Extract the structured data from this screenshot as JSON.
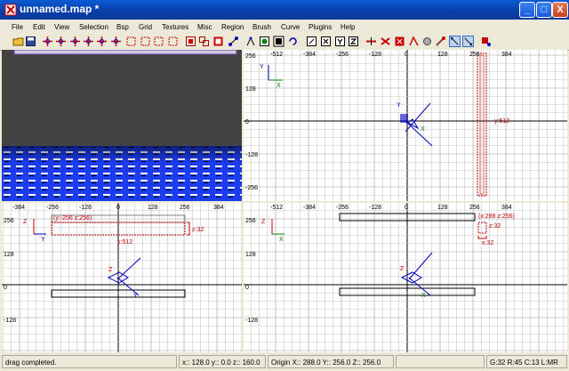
{
  "window": {
    "title": "unnamed.map *",
    "min_label": "_",
    "max_label": "□",
    "close_label": "X"
  },
  "menu": {
    "items": [
      "File",
      "Edit",
      "View",
      "Selection",
      "Bsp",
      "Grid",
      "Textures",
      "Misc",
      "Region",
      "Brush",
      "Curve",
      "Plugins",
      "Help"
    ]
  },
  "colors": {
    "accent": "#0a3fa8",
    "brush_outline": "#c00000",
    "grid": "#c8c8c8",
    "grid_major": "#9a9a9a",
    "texture_blue": "#1c3cf0"
  },
  "top_right": {
    "x_ticks": [
      "-512",
      "-384",
      "-256",
      "-128",
      "0",
      "128",
      "256",
      "384"
    ],
    "y_ticks": [
      "256",
      "128",
      "0",
      "-128",
      "-256"
    ],
    "size_label": "y:512",
    "axis": {
      "v": "Y",
      "h": "X"
    }
  },
  "bottom_left": {
    "x_ticks": [
      "-384",
      "-256",
      "-128",
      "0",
      "128",
      "256",
      "384"
    ],
    "y_ticks": [
      "256",
      "128",
      "0",
      "-128"
    ],
    "coord_label": "(y:-256 z:256)",
    "height_label": "z:32",
    "size_label": "y:512",
    "axis": {
      "v": "Z",
      "h": "Y"
    }
  },
  "bottom_right": {
    "x_ticks": [
      "-512",
      "-384",
      "-256",
      "-128",
      "0",
      "128",
      "256",
      "384"
    ],
    "y_ticks": [
      "256",
      "128",
      "0",
      "-128"
    ],
    "coord_label": "(x:288 z:256)",
    "height_label": "z:32",
    "size_label": "x:32",
    "axis": {
      "v": "Z",
      "h": "X"
    }
  },
  "status": {
    "message": "drag completed.",
    "coords": "x:: 128.0  y:: 0.0  z:: 160.0",
    "origin": "Origin X:: 288.0  Y:: 256.0  Z:: 256.0",
    "grid": "G:32 R:45 C:13 L:MR"
  }
}
